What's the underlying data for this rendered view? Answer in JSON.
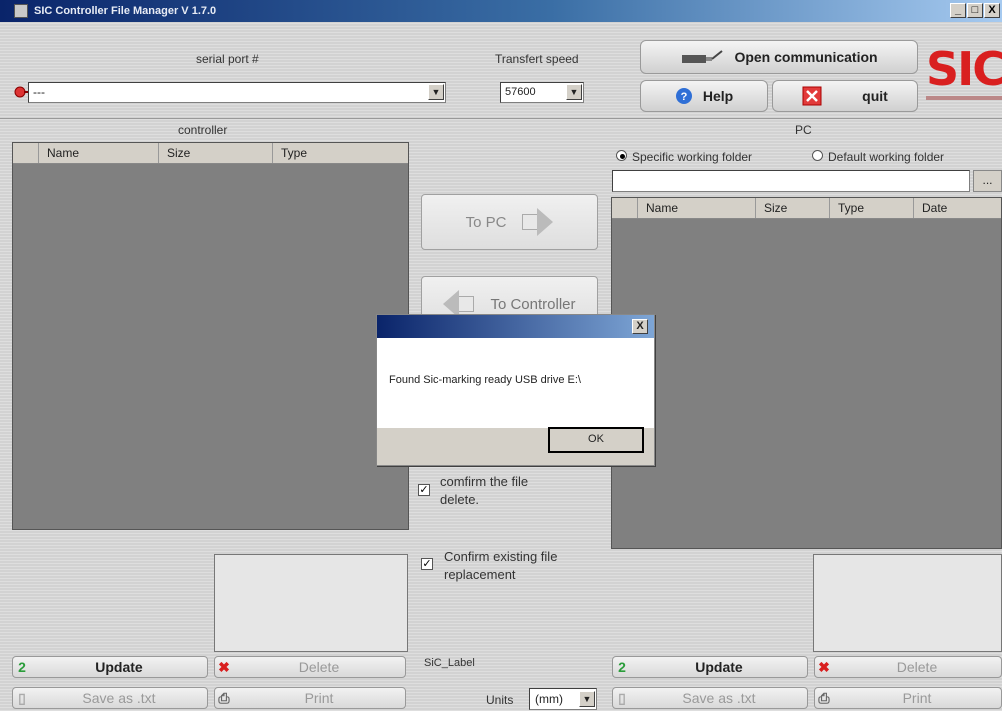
{
  "window": {
    "title": "SIC Controller File Manager V 1.7.0",
    "minimize": "_",
    "maximize": "□",
    "close": "X"
  },
  "serial": {
    "label": "serial port #",
    "value": "---"
  },
  "speed": {
    "label": "Transfert speed",
    "value": "57600"
  },
  "buttons": {
    "open_communication": "Open communication",
    "help": "Help",
    "quit": "quit",
    "to_pc": "To PC",
    "to_controller": "To Controller",
    "browse": "..."
  },
  "logo": {
    "text": "SIC"
  },
  "controller": {
    "label": "controller",
    "columns": [
      "Name",
      "Size",
      "Type"
    ]
  },
  "pc": {
    "label": "PC",
    "radio_specific": "Specific working folder",
    "radio_default": "Default working folder",
    "selected": "specific",
    "folder_value": "",
    "columns": [
      "Name",
      "Size",
      "Type",
      "Date"
    ]
  },
  "options": {
    "confirm_delete": "comfirm the file delete.",
    "confirm_delete_checked": true,
    "confirm_replace": "Confirm existing file replacement",
    "confirm_replace_checked": true,
    "sic_label": "SiC_Label",
    "units_label": "Units",
    "units_value": "(mm)"
  },
  "left_actions": {
    "update": "Update",
    "delete": "Delete",
    "save_txt": "Save as .txt",
    "print": "Print"
  },
  "right_actions": {
    "update": "Update",
    "delete": "Delete",
    "save_txt": "Save as .txt",
    "print": "Print"
  },
  "dialog": {
    "message": "Found Sic-marking ready USB drive E:\\",
    "ok": "OK",
    "close": "X"
  },
  "colors": {
    "title_bar": "#0a246a",
    "logo_red": "#d91f1f",
    "list_bg": "#808080",
    "update_green": "#2a9d3a",
    "delete_red": "#d91f1f"
  }
}
